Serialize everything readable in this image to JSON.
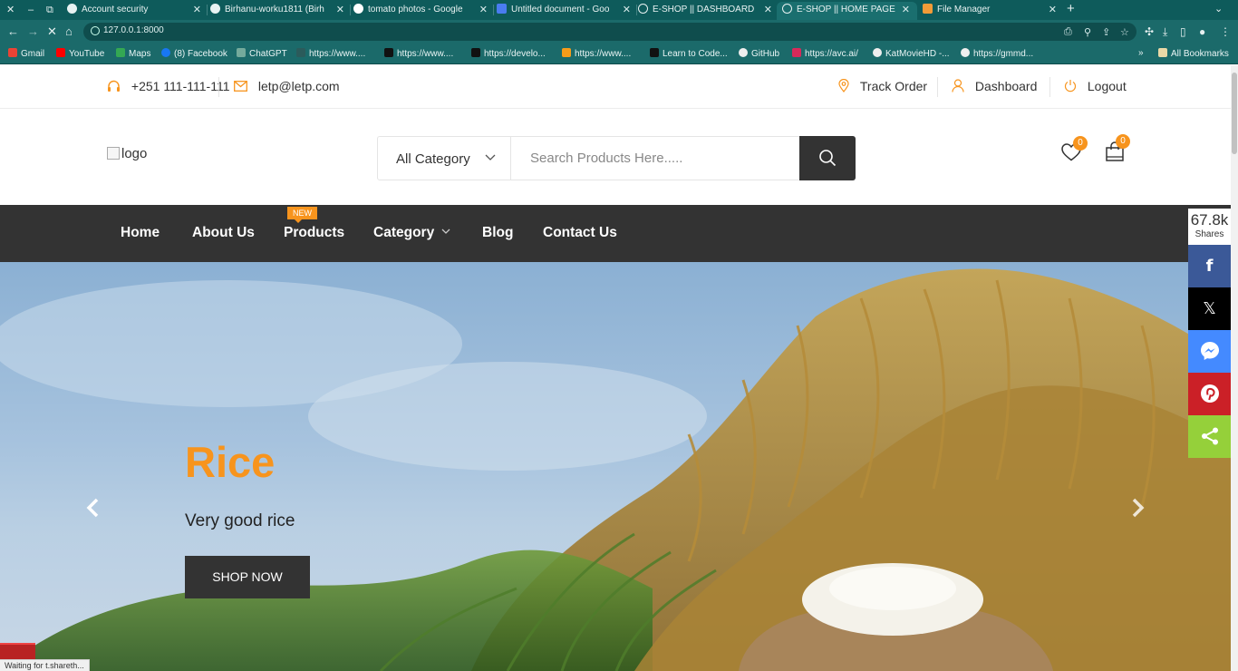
{
  "browser": {
    "tabs": [
      {
        "title": "Account security",
        "color": "#e8f2f2",
        "active": false
      },
      {
        "title": "Birhanu-worku1811 (Birh",
        "color": "#e8f2f2",
        "active": false
      },
      {
        "title": "tomato photos - Google",
        "color": "#4285f4",
        "active": false
      },
      {
        "title": "Untitled document - Goo",
        "color": "#4a7cf0",
        "active": false
      },
      {
        "title": "E-SHOP || DASHBOARD",
        "color": "#e8f2f2",
        "active": false
      },
      {
        "title": "E-SHOP || HOME PAGE",
        "color": "#e8f2f2",
        "active": true
      },
      {
        "title": "File Manager",
        "color": "#f29b38",
        "active": false
      }
    ],
    "url": "127.0.0.1:8000",
    "bookmarks": [
      {
        "label": "Gmail",
        "color": "#ea4335"
      },
      {
        "label": "YouTube",
        "color": "#ff0000"
      },
      {
        "label": "Maps",
        "color": "#34a853"
      },
      {
        "label": "(8) Facebook",
        "color": "#1877f2"
      },
      {
        "label": "ChatGPT",
        "color": "#74aa9c"
      },
      {
        "label": "https://www....",
        "color": "#2b5b5b"
      },
      {
        "label": "https://www....",
        "color": "#111111"
      },
      {
        "label": "https://develo...",
        "color": "#111111"
      },
      {
        "label": "https://www....",
        "color": "#f59c1a"
      },
      {
        "label": "Learn to Code...",
        "color": "#111111"
      },
      {
        "label": "GitHub",
        "color": "#eeeeee"
      },
      {
        "label": "https://avc.ai/",
        "color": "#d62a5a"
      },
      {
        "label": "KatMovieHD -...",
        "color": "#eeeeee"
      },
      {
        "label": "https://gmmd...",
        "color": "#eeeeee"
      }
    ],
    "all_bookmarks": "All Bookmarks",
    "status_text": "Waiting for t.shareth..."
  },
  "topbar": {
    "phone": "+251 111-111-111",
    "email": "letp@letp.com",
    "track_order": "Track Order",
    "dashboard": "Dashboard",
    "logout": "Logout"
  },
  "header": {
    "logo_alt": "logo",
    "category_selected": "All Category",
    "search_placeholder": "Search Products Here.....",
    "wishlist_count": "0",
    "cart_count": "0"
  },
  "nav": {
    "home": "Home",
    "about": "About Us",
    "products": "Products",
    "new_badge": "NEW",
    "category": "Category",
    "blog": "Blog",
    "contact": "Contact Us"
  },
  "hero": {
    "title": "Rice",
    "subtitle": "Very good rice",
    "button": "SHOP NOW"
  },
  "share": {
    "count": "67.8k",
    "label": "Shares",
    "buttons": [
      {
        "name": "facebook",
        "color": "#3b5998"
      },
      {
        "name": "x",
        "color": "#000000"
      },
      {
        "name": "messenger",
        "color": "#448aff"
      },
      {
        "name": "pinterest",
        "color": "#cb2027"
      },
      {
        "name": "sharethis",
        "color": "#95d03a"
      }
    ]
  }
}
